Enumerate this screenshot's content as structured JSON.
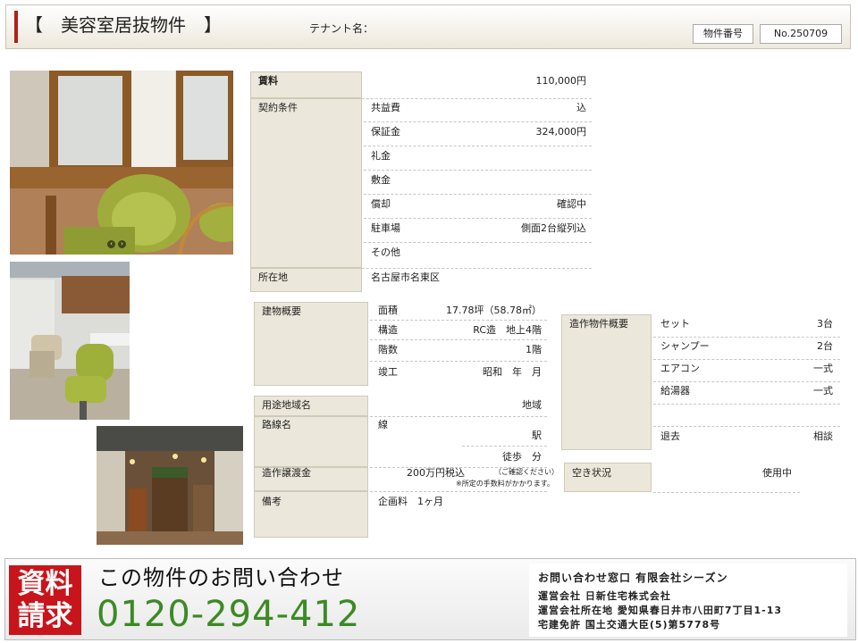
{
  "header": {
    "title": "【　美容室居抜物件　】",
    "tenant_label": "テナント名：",
    "property_number_label": "物件番号",
    "property_number": "No.250709"
  },
  "rent": {
    "label": "賃料",
    "value": "110,000円"
  },
  "contract": {
    "label": "契約条件",
    "rows": [
      {
        "name": "共益費",
        "value": "込"
      },
      {
        "name": "保証金",
        "value": "324,000円"
      },
      {
        "name": "礼金",
        "value": ""
      },
      {
        "name": "敷金",
        "value": ""
      },
      {
        "name": "償却",
        "value": "確認中"
      },
      {
        "name": "駐車場",
        "value": "側面2台縦列込"
      },
      {
        "name": "その他",
        "value": ""
      }
    ]
  },
  "location": {
    "label": "所在地",
    "value": "名古屋市名東区"
  },
  "building": {
    "label": "建物概要",
    "rows": [
      {
        "name": "面積",
        "value": "17.78坪（58.78㎡）"
      },
      {
        "name": "構造",
        "value": "RC造　地上4階"
      },
      {
        "name": "階数",
        "value": "1階"
      },
      {
        "name": "竣工",
        "value": "昭和　年　月"
      }
    ]
  },
  "fixtures": {
    "label": "造作物件概要",
    "rows": [
      {
        "name": "セット",
        "value": "3台"
      },
      {
        "name": "シャンプー",
        "value": "2台"
      },
      {
        "name": "エアコン",
        "value": "一式"
      },
      {
        "name": "給湯器",
        "value": "一式"
      },
      {
        "name": "",
        "value": ""
      },
      {
        "name": "退去",
        "value": "相談"
      }
    ]
  },
  "zoning": {
    "label": "用途地域名",
    "value": "地域"
  },
  "route": {
    "label": "路線名",
    "line": "線",
    "station": "駅",
    "walk": "徒歩　分"
  },
  "transfer": {
    "label": "造作譲渡金",
    "value": "200万円税込",
    "note1": "（ご確認ください）",
    "note2": "※所定の手数料がかかります。"
  },
  "vacancy": {
    "label": "空き状況",
    "value": "使用中"
  },
  "remarks": {
    "label": "備考",
    "value": "企画料　1ヶ月"
  },
  "footer": {
    "request_line1": "資料",
    "request_line2": "請求",
    "inquiry_heading": "この物件のお問い合わせ",
    "phone": "0120-294-412",
    "info": [
      "お問い合わせ窓口 有限会社シーズン",
      "運営会社 日新住宅株式会社",
      "運営会社所在地 愛知県春日井市八田町7丁目1-13",
      "宅建免許 国土交通大臣(5)第5778号"
    ]
  },
  "colors": {
    "accent_red": "#b0201c",
    "label_bg": "#ebe7da",
    "request_red": "#c8151b",
    "phone_green": "#3c8a24"
  }
}
